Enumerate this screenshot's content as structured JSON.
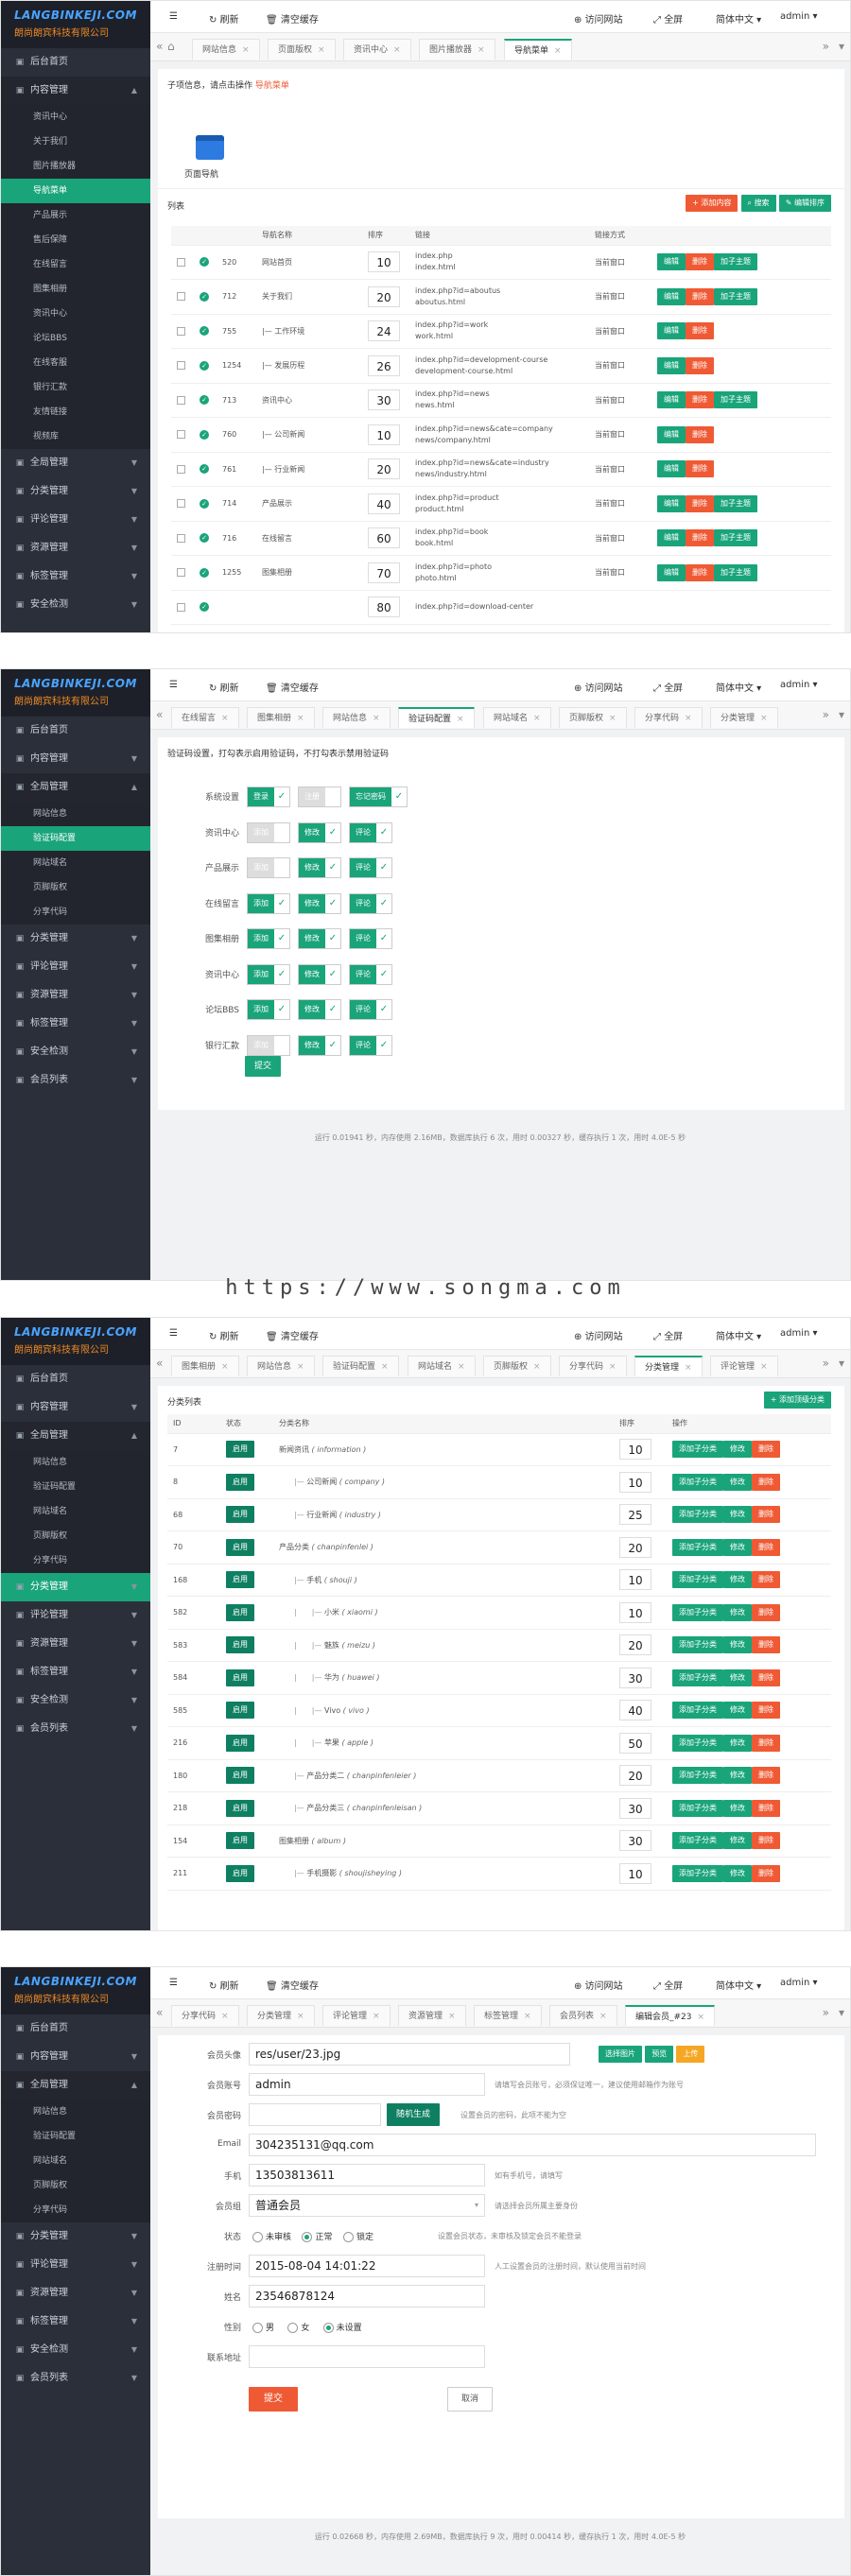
{
  "logo": {
    "title": "LANGBINKEJI.COM",
    "subtitle": "朗尚朗宾科技有限公司"
  },
  "topbar": {
    "menu_icon": "☰",
    "refresh": "刷新",
    "clear": "清空缓存",
    "visit": "访问网站",
    "fullscreen": "全屏",
    "lang": "简体中文",
    "user": "admin"
  },
  "panel1": {
    "sidebar": [
      {
        "label": "后台首页",
        "type": "item"
      },
      {
        "label": "内容管理",
        "type": "open"
      },
      {
        "label": "资讯中心",
        "type": "sub"
      },
      {
        "label": "关于我们",
        "type": "sub"
      },
      {
        "label": "图片播放器",
        "type": "sub"
      },
      {
        "label": "导航菜单",
        "type": "subact"
      },
      {
        "label": "产品展示",
        "type": "sub"
      },
      {
        "label": "售后保障",
        "type": "sub"
      },
      {
        "label": "在线留言",
        "type": "sub"
      },
      {
        "label": "图集相册",
        "type": "sub"
      },
      {
        "label": "资讯中心",
        "type": "sub"
      },
      {
        "label": "论坛BBS",
        "type": "sub"
      },
      {
        "label": "在线客服",
        "type": "sub"
      },
      {
        "label": "银行汇款",
        "type": "sub"
      },
      {
        "label": "友情链接",
        "type": "sub"
      },
      {
        "label": "视频库",
        "type": "sub"
      },
      {
        "label": "全局管理",
        "type": "item"
      },
      {
        "label": "分类管理",
        "type": "item"
      },
      {
        "label": "评论管理",
        "type": "item"
      },
      {
        "label": "资源管理",
        "type": "item"
      },
      {
        "label": "标签管理",
        "type": "item"
      },
      {
        "label": "安全检测",
        "type": "item"
      }
    ],
    "tabs": [
      "网站信息",
      "页面版权",
      "资讯中心",
      "图片播放器",
      "导航菜单"
    ],
    "info": "子项信息，请点击操作",
    "info_link": "导航菜单",
    "page_nav_label": "页面导航",
    "list_label": "列表",
    "btn_add": "添加内容",
    "btn_search": "搜索",
    "btn_edit": "编辑排序",
    "headers": [
      "",
      "",
      "",
      "导航名称",
      "排序",
      "链接",
      "链接方式",
      ""
    ],
    "rows": [
      {
        "id": "520",
        "name": "网站首页",
        "sort": "10",
        "link1": "index.php",
        "link2": "index.html",
        "mode": "当前窗口",
        "child": true
      },
      {
        "id": "712",
        "name": "关于我们",
        "sort": "20",
        "link1": "index.php?id=aboutus",
        "link2": "aboutus.html",
        "mode": "当前窗口",
        "child": true
      },
      {
        "id": "755",
        "name": "|— 工作环境",
        "sort": "24",
        "link1": "index.php?id=work",
        "link2": "work.html",
        "mode": "当前窗口",
        "child": false
      },
      {
        "id": "1254",
        "name": "|— 发展历程",
        "sort": "26",
        "link1": "index.php?id=development-course",
        "link2": "development-course.html",
        "mode": "当前窗口",
        "child": false
      },
      {
        "id": "713",
        "name": "资讯中心",
        "sort": "30",
        "link1": "index.php?id=news",
        "link2": "news.html",
        "mode": "当前窗口",
        "child": true
      },
      {
        "id": "760",
        "name": "|— 公司新闻",
        "sort": "10",
        "link1": "index.php?id=news&cate=company",
        "link2": "news/company.html",
        "mode": "当前窗口",
        "child": false
      },
      {
        "id": "761",
        "name": "|— 行业新闻",
        "sort": "20",
        "link1": "index.php?id=news&cate=industry",
        "link2": "news/industry.html",
        "mode": "当前窗口",
        "child": false
      },
      {
        "id": "714",
        "name": "产品展示",
        "sort": "40",
        "link1": "index.php?id=product",
        "link2": "product.html",
        "mode": "当前窗口",
        "child": true
      },
      {
        "id": "716",
        "name": "在线留言",
        "sort": "60",
        "link1": "index.php?id=book",
        "link2": "book.html",
        "mode": "当前窗口",
        "child": true
      },
      {
        "id": "1255",
        "name": "图集相册",
        "sort": "70",
        "link1": "index.php?id=photo",
        "link2": "photo.html",
        "mode": "当前窗口",
        "child": true
      },
      {
        "id": "",
        "name": "",
        "sort": "80",
        "link1": "index.php?id=download-center",
        "link2": "",
        "mode": "",
        "child": false
      }
    ],
    "act_edit": "编辑",
    "act_del": "删除",
    "act_child": "加子主题"
  },
  "panel2": {
    "sidebar": [
      {
        "label": "后台首页",
        "type": "item"
      },
      {
        "label": "内容管理",
        "type": "item"
      },
      {
        "label": "全局管理",
        "type": "open"
      },
      {
        "label": "网站信息",
        "type": "sub"
      },
      {
        "label": "验证码配置",
        "type": "subact"
      },
      {
        "label": "网站域名",
        "type": "sub"
      },
      {
        "label": "页脚版权",
        "type": "sub"
      },
      {
        "label": "分享代码",
        "type": "sub"
      },
      {
        "label": "分类管理",
        "type": "item"
      },
      {
        "label": "评论管理",
        "type": "item"
      },
      {
        "label": "资源管理",
        "type": "item"
      },
      {
        "label": "标签管理",
        "type": "item"
      },
      {
        "label": "安全检测",
        "type": "item"
      },
      {
        "label": "会员列表",
        "type": "item"
      }
    ],
    "tabs": [
      "在线留言",
      "图集相册",
      "网站信息",
      "验证码配置",
      "网站域名",
      "页脚版权",
      "分享代码",
      "分类管理"
    ],
    "desc": "验证码设置，打勾表示启用验证码，不打勾表示禁用验证码",
    "rows": [
      {
        "label": "系统设置",
        "items": [
          {
            "t": "登录",
            "on": true
          },
          {
            "t": "注册",
            "on": false
          },
          {
            "t": "忘记密码",
            "on": true
          }
        ]
      },
      {
        "label": "资讯中心",
        "items": [
          {
            "t": "添加",
            "on": false
          },
          {
            "t": "修改",
            "on": true
          },
          {
            "t": "评论",
            "on": true
          }
        ]
      },
      {
        "label": "产品展示",
        "items": [
          {
            "t": "添加",
            "on": false
          },
          {
            "t": "修改",
            "on": true
          },
          {
            "t": "评论",
            "on": true
          }
        ]
      },
      {
        "label": "在线留言",
        "items": [
          {
            "t": "添加",
            "on": true
          },
          {
            "t": "修改",
            "on": true
          },
          {
            "t": "评论",
            "on": true
          }
        ]
      },
      {
        "label": "图集相册",
        "items": [
          {
            "t": "添加",
            "on": true
          },
          {
            "t": "修改",
            "on": true
          },
          {
            "t": "评论",
            "on": true
          }
        ]
      },
      {
        "label": "资讯中心",
        "items": [
          {
            "t": "添加",
            "on": true
          },
          {
            "t": "修改",
            "on": true
          },
          {
            "t": "评论",
            "on": true
          }
        ]
      },
      {
        "label": "论坛BBS",
        "items": [
          {
            "t": "添加",
            "on": true
          },
          {
            "t": "修改",
            "on": true
          },
          {
            "t": "评论",
            "on": true
          }
        ]
      },
      {
        "label": "银行汇款",
        "items": [
          {
            "t": "添加",
            "on": false
          },
          {
            "t": "修改",
            "on": true
          },
          {
            "t": "评论",
            "on": true
          }
        ]
      }
    ],
    "submit": "提交",
    "footer": "运行 0.01941 秒，内存使用 2.16MB，数据库执行 6 次，用时 0.00327 秒，缓存执行 1 次，用时 4.0E-5 秒"
  },
  "watermark": "https://www.songma.com",
  "panel3": {
    "sidebar": [
      {
        "label": "后台首页",
        "type": "item"
      },
      {
        "label": "内容管理",
        "type": "item"
      },
      {
        "label": "全局管理",
        "type": "open"
      },
      {
        "label": "网站信息",
        "type": "sub"
      },
      {
        "label": "验证码配置",
        "type": "sub"
      },
      {
        "label": "网站域名",
        "type": "sub"
      },
      {
        "label": "页脚版权",
        "type": "sub"
      },
      {
        "label": "分享代码",
        "type": "sub"
      },
      {
        "label": "分类管理",
        "type": "act"
      },
      {
        "label": "评论管理",
        "type": "item"
      },
      {
        "label": "资源管理",
        "type": "item"
      },
      {
        "label": "标签管理",
        "type": "item"
      },
      {
        "label": "安全检测",
        "type": "item"
      },
      {
        "label": "会员列表",
        "type": "item"
      }
    ],
    "tabs": [
      "图集相册",
      "网站信息",
      "验证码配置",
      "网站域名",
      "页脚版权",
      "分享代码",
      "分类管理",
      "评论管理"
    ],
    "title": "分类列表",
    "btn_add": "添加顶级分类",
    "headers": [
      "ID",
      "状态",
      "分类名称",
      "排序",
      "操作"
    ],
    "rows": [
      {
        "id": "7",
        "name": "新闻资讯",
        "slug": "information",
        "sort": "10",
        "lvl": 0
      },
      {
        "id": "8",
        "name": "公司新闻",
        "slug": "company",
        "sort": "10",
        "lvl": 1
      },
      {
        "id": "68",
        "name": "行业新闻",
        "slug": "industry",
        "sort": "25",
        "lvl": 1
      },
      {
        "id": "70",
        "name": "产品分类",
        "slug": "chanpinfenlei",
        "sort": "20",
        "lvl": 0
      },
      {
        "id": "168",
        "name": "手机",
        "slug": "shouji",
        "sort": "10",
        "lvl": 1
      },
      {
        "id": "582",
        "name": "小米",
        "slug": "xiaomi",
        "sort": "10",
        "lvl": 2
      },
      {
        "id": "583",
        "name": "魅族",
        "slug": "meizu",
        "sort": "20",
        "lvl": 2
      },
      {
        "id": "584",
        "name": "华为",
        "slug": "huawei",
        "sort": "30",
        "lvl": 2
      },
      {
        "id": "585",
        "name": "Vivo",
        "slug": "vivo",
        "sort": "40",
        "lvl": 2
      },
      {
        "id": "216",
        "name": "苹果",
        "slug": "apple",
        "sort": "50",
        "lvl": 2
      },
      {
        "id": "180",
        "name": "产品分类二",
        "slug": "chanpinfenleier",
        "sort": "20",
        "lvl": 1
      },
      {
        "id": "218",
        "name": "产品分类三",
        "slug": "chanpinfenleisan",
        "sort": "30",
        "lvl": 1
      },
      {
        "id": "154",
        "name": "图集相册",
        "slug": "album",
        "sort": "30",
        "lvl": 0
      },
      {
        "id": "211",
        "name": "手机摄影",
        "slug": "shoujisheying",
        "sort": "10",
        "lvl": 1
      }
    ],
    "status": "启用",
    "act_add": "添加子分类",
    "act_edit": "修改",
    "act_del": "删除"
  },
  "panel4": {
    "sidebar": [
      {
        "label": "后台首页",
        "type": "item"
      },
      {
        "label": "内容管理",
        "type": "item"
      },
      {
        "label": "全局管理",
        "type": "open"
      },
      {
        "label": "网站信息",
        "type": "sub"
      },
      {
        "label": "验证码配置",
        "type": "sub"
      },
      {
        "label": "网站域名",
        "type": "sub"
      },
      {
        "label": "页脚版权",
        "type": "sub"
      },
      {
        "label": "分享代码",
        "type": "sub"
      },
      {
        "label": "分类管理",
        "type": "item"
      },
      {
        "label": "评论管理",
        "type": "item"
      },
      {
        "label": "资源管理",
        "type": "item"
      },
      {
        "label": "标签管理",
        "type": "item"
      },
      {
        "label": "安全检测",
        "type": "item"
      },
      {
        "label": "会员列表",
        "type": "item"
      }
    ],
    "tabs": [
      "分享代码",
      "分类管理",
      "评论管理",
      "资源管理",
      "标签管理",
      "会员列表",
      "编辑会员_#23"
    ],
    "avatar_label": "会员头像",
    "avatar_value": "res/user/23.jpg",
    "btn_pick": "选择图片",
    "btn_preview": "预览",
    "btn_up": "上传",
    "account_label": "会员账号",
    "account_value": "admin",
    "account_hint": "请填写会员账号，必须保证唯一，建议使用邮箱作为账号",
    "pwd_label": "会员密码",
    "pwd_btn": "随机生成",
    "pwd_hint": "设置会员的密码，此项不能为空",
    "email_label": "Email",
    "email_value": "304235131@qq.com",
    "phone_label": "手机",
    "phone_value": "13503813611",
    "phone_hint": "如有手机号，请填写",
    "group_label": "会员组",
    "group_value": "普通会员",
    "group_hint": "请选择会员所属主要身份",
    "state_label": "状态",
    "states": [
      "未审核",
      "正常",
      "锁定"
    ],
    "state_hint": "设置会员状态，未审核及锁定会员不能登录",
    "reg_label": "注册时间",
    "reg_value": "2015-08-04 14:01:22",
    "reg_hint": "人工设置会员的注册时间，默认使用当前时间",
    "name_label": "姓名",
    "name_value": "23546878124",
    "gender_label": "性别",
    "genders": [
      "男",
      "女",
      "未设置"
    ],
    "addr_label": "联系地址",
    "submit": "提交",
    "cancel": "取消",
    "footer": "运行 0.02668 秒，内存使用 2.69MB，数据库执行 9 次，用时 0.00414 秒，缓存执行 1 次，用时 4.0E-5 秒"
  }
}
